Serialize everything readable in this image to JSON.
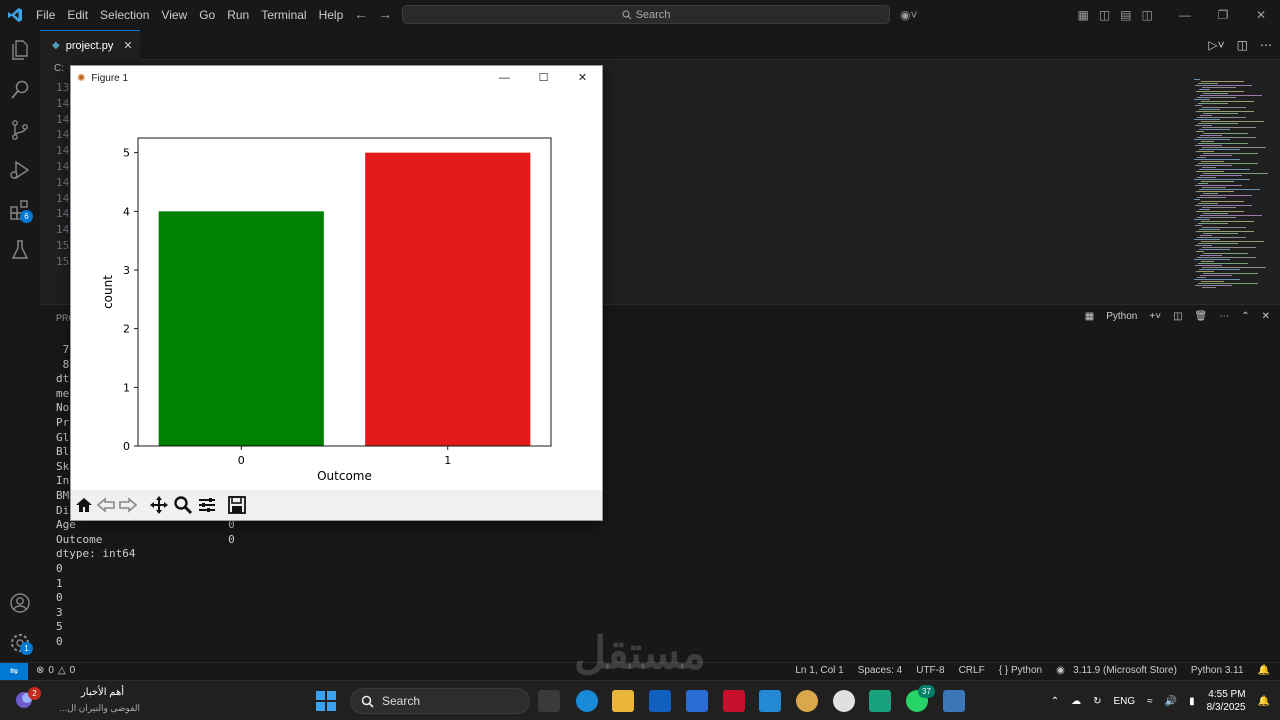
{
  "titlebar": {
    "menus": [
      "File",
      "Edit",
      "Selection",
      "View",
      "Go",
      "Run",
      "Terminal",
      "Help"
    ],
    "search_placeholder": "Search"
  },
  "activity_bar": {
    "icons": [
      "files-icon",
      "search-icon",
      "source-control-icon",
      "run-debug-icon",
      "extensions-icon",
      "testing-icon",
      "account-icon",
      "settings-gear-icon"
    ],
    "extensions_badge": "6",
    "settings_badge": "1"
  },
  "editor": {
    "tab_label": "project.py",
    "breadcrumb_prefix": "C:",
    "line_numbers": [
      "13",
      "14",
      "14",
      "14",
      "14",
      "14",
      "14",
      "14",
      "14",
      "14",
      "15",
      "15"
    ]
  },
  "panel": {
    "label_fragment": "PRO",
    "terminal_profile": "Python",
    "lines": [
      " 7",
      " 8",
      "dt",
      "me",
      "No",
      "Pr",
      "Gl",
      "Bl",
      "Sk",
      "In",
      "BM",
      "Di",
      "Age                       0",
      "Outcome                   0",
      "dtype: int64",
      "0",
      "1",
      "0",
      "3",
      "5",
      "0"
    ]
  },
  "statusbar": {
    "errors": "0",
    "warnings": "0",
    "cursor": "Ln 1, Col 1",
    "spaces": "Spaces: 4",
    "encoding": "UTF-8",
    "eol": "CRLF",
    "language": "Python",
    "interpreter": "3.11.9 (Microsoft Store)",
    "python_version": "Python 3.11"
  },
  "figure": {
    "window_title": "Figure 1"
  },
  "chart_data": {
    "type": "bar",
    "categories": [
      "0",
      "1"
    ],
    "values": [
      4,
      5
    ],
    "colors": [
      "#008000",
      "#e31a1c"
    ],
    "title": "",
    "xlabel": "Outcome",
    "ylabel": "count",
    "ylim": [
      0,
      5.25
    ],
    "yticks": [
      "0",
      "1",
      "2",
      "3",
      "4",
      "5"
    ]
  },
  "taskbar": {
    "news_title": "أهم الأخبار",
    "news_subtitle": "الفوضى والنيران ال...",
    "news_badge": "2",
    "search_placeholder": "Search",
    "whatsapp_badge": "37",
    "language": "ENG",
    "time": "4:55 PM",
    "date": "8/3/2025"
  },
  "watermark": "مستقل"
}
